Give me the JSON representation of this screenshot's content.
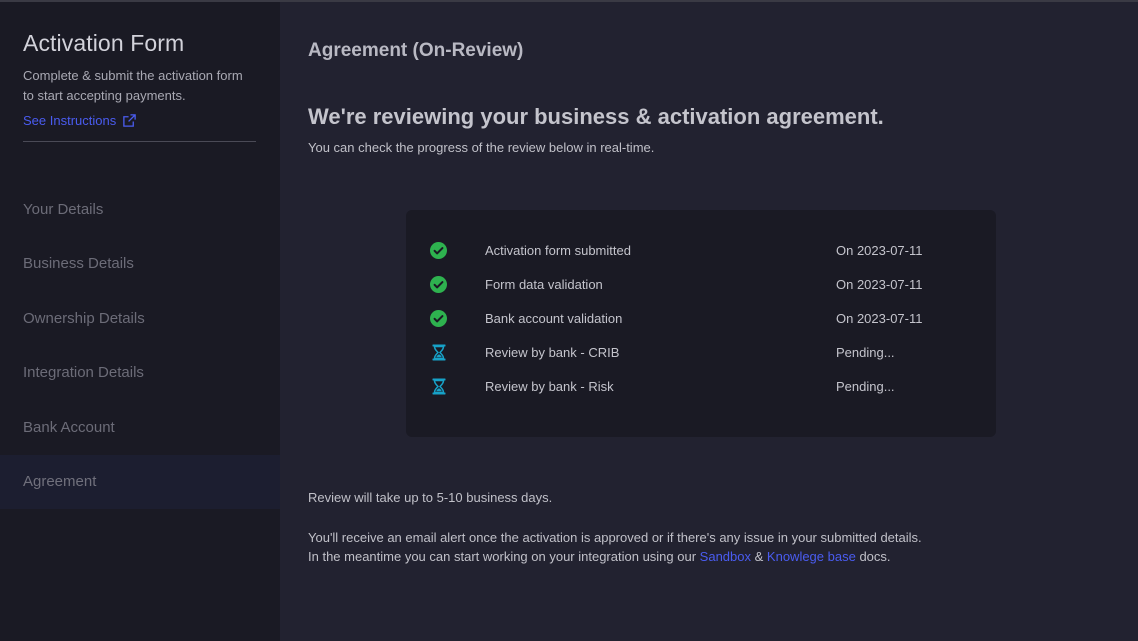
{
  "sidebar": {
    "title": "Activation Form",
    "subtitle_line1": "Complete & submit the activation form",
    "subtitle_line2": "to start accepting payments.",
    "instructions_link": "See Instructions",
    "nav_items": [
      {
        "label": "Your Details",
        "active": false
      },
      {
        "label": "Business Details",
        "active": false
      },
      {
        "label": "Ownership Details",
        "active": false
      },
      {
        "label": "Integration Details",
        "active": false
      },
      {
        "label": "Bank Account",
        "active": false
      },
      {
        "label": "Agreement",
        "active": true
      }
    ]
  },
  "main": {
    "heading": "Agreement (On-Review)",
    "review_title": "We're reviewing your business & activation agreement.",
    "review_subtitle": "You can check the progress of the review below in real-time.",
    "steps": [
      {
        "label": "Activation form submitted",
        "status": "On 2023-07-11",
        "icon": "check-circle-icon"
      },
      {
        "label": "Form data validation",
        "status": "On 2023-07-11",
        "icon": "check-circle-icon"
      },
      {
        "label": "Bank account validation",
        "status": "On 2023-07-11",
        "icon": "check-circle-icon"
      },
      {
        "label": "Review by bank - CRIB",
        "status": "Pending...",
        "icon": "hourglass-icon"
      },
      {
        "label": "Review by bank - Risk",
        "status": "Pending...",
        "icon": "hourglass-icon"
      }
    ],
    "review_duration": "Review will take up to 5-10 business days.",
    "email_note": "You'll receive an email alert once the activation is approved or if there's any issue in your submitted details.",
    "meantime_prefix": "In the meantime you can start working on your integration using our",
    "sandbox_link": "Sandbox",
    "ampersand": "&",
    "knowledge_link": "Knowlege base",
    "meantime_suffix": "docs."
  },
  "colors": {
    "accent_link": "#4a5cf0",
    "check_green": "#2eb24f",
    "hourglass_cyan": "#17a2c8"
  }
}
